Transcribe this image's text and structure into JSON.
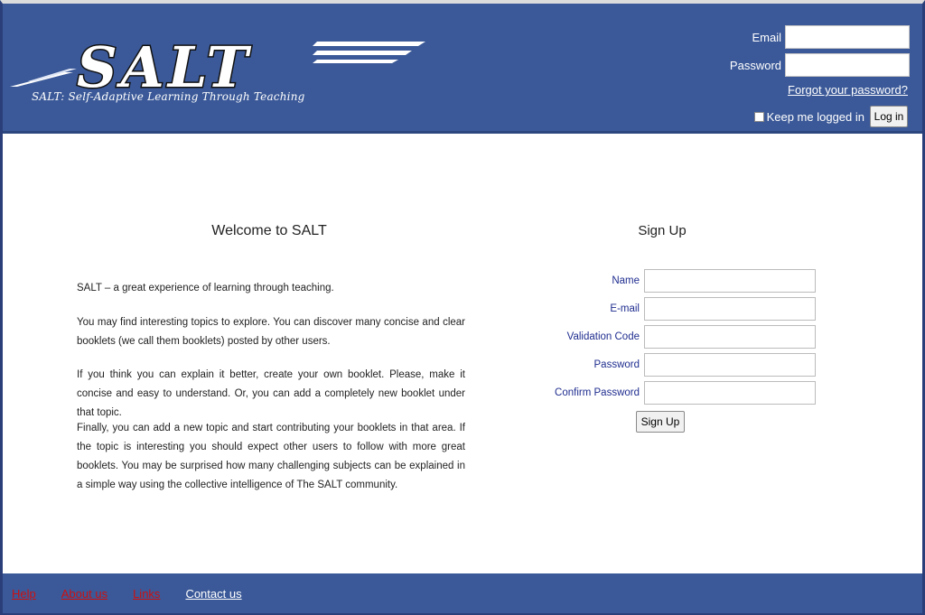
{
  "header": {
    "logo_text": "SALT",
    "tagline": "SALT: Self-Adaptive Learning Through Teaching",
    "email_label": "Email",
    "password_label": "Password",
    "email_value": "",
    "password_value": "",
    "forgot_password": "Forgot your password?",
    "keep_logged_in": "Keep me logged in",
    "login_button": "Log in"
  },
  "welcome": {
    "title": "Welcome to SALT",
    "paragraphs": [
      "SALT – a great experience of learning through teaching.",
      "You may find interesting topics to explore. You can discover many concise and clear booklets (we call them booklets) posted by other users.",
      "If you think you can explain it better, create your own booklet. Please, make it concise and easy to understand. Or, you can add a completely new booklet under that topic.",
      "Finally, you can add a new topic and start contributing your booklets in that area. If the topic is interesting you should expect other users to follow with more great booklets. You may be surprised how many challenging subjects can be explained in a simple way using the collective intelligence of The SALT community."
    ]
  },
  "signup": {
    "title": "Sign Up",
    "fields": [
      {
        "label": "Name",
        "value": ""
      },
      {
        "label": "E-mail",
        "value": ""
      },
      {
        "label": "Validation Code",
        "value": ""
      },
      {
        "label": "Password",
        "value": ""
      },
      {
        "label": "Confirm Password",
        "value": ""
      }
    ],
    "button": "Sign Up"
  },
  "footer": {
    "links": [
      {
        "label": "Help",
        "color": "#cc1111"
      },
      {
        "label": "About us",
        "color": "#cc1111"
      },
      {
        "label": "Links",
        "color": "#cc1111"
      },
      {
        "label": "Contact us",
        "color": "#ffffff"
      }
    ]
  },
  "colors": {
    "brand_blue": "#3b5998",
    "label_blue": "#1f2d8f",
    "footer_red": "#cc1111"
  }
}
